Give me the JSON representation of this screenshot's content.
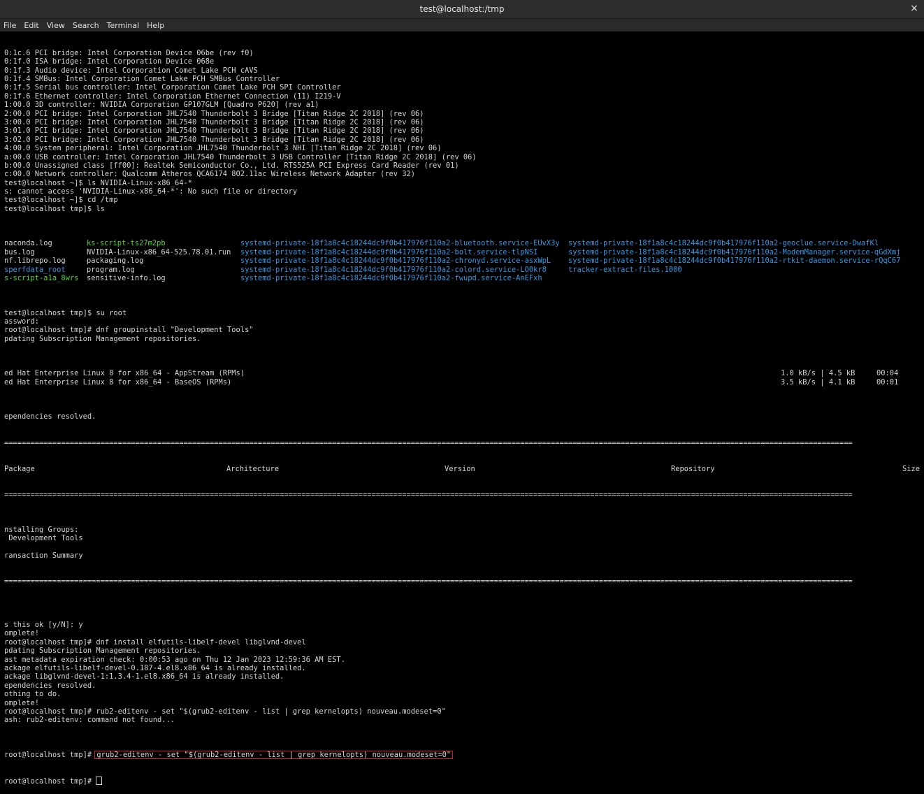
{
  "window": {
    "title": "test@localhost:/tmp",
    "close_glyph": "×"
  },
  "menu": [
    "File",
    "Edit",
    "View",
    "Search",
    "Terminal",
    "Help"
  ],
  "lines_top": [
    "0:1c.6 PCI bridge: Intel Corporation Device 06be (rev f0)",
    "0:1f.0 ISA bridge: Intel Corporation Device 068e",
    "0:1f.3 Audio device: Intel Corporation Comet Lake PCH cAVS",
    "0:1f.4 SMBus: Intel Corporation Comet Lake PCH SMBus Controller",
    "0:1f.5 Serial bus controller: Intel Corporation Comet Lake PCH SPI Controller",
    "0:1f.6 Ethernet controller: Intel Corporation Ethernet Connection (11) I219-V",
    "1:00.0 3D controller: NVIDIA Corporation GP107GLM [Quadro P620] (rev a1)",
    "2:00.0 PCI bridge: Intel Corporation JHL7540 Thunderbolt 3 Bridge [Titan Ridge 2C 2018] (rev 06)",
    "3:00.0 PCI bridge: Intel Corporation JHL7540 Thunderbolt 3 Bridge [Titan Ridge 2C 2018] (rev 06)",
    "3:01.0 PCI bridge: Intel Corporation JHL7540 Thunderbolt 3 Bridge [Titan Ridge 2C 2018] (rev 06)",
    "3:02.0 PCI bridge: Intel Corporation JHL7540 Thunderbolt 3 Bridge [Titan Ridge 2C 2018] (rev 06)",
    "4:00.0 System peripheral: Intel Corporation JHL7540 Thunderbolt 3 NHI [Titan Ridge 2C 2018] (rev 06)",
    "a:00.0 USB controller: Intel Corporation JHL7540 Thunderbolt 3 USB Controller [Titan Ridge 2C 2018] (rev 06)",
    "b:00.0 Unassigned class [ff00]: Realtek Semiconductor Co., Ltd. RTS525A PCI Express Card Reader (rev 01)",
    "c:00.0 Network controller: Qualcomm Atheros QCA6174 802.11ac Wireless Network Adapter (rev 32)",
    "test@localhost ~]$ ls NVIDIA-Linux-x86_64-*",
    "s: cannot access 'NVIDIA-Linux-x86_64-*': No such file or directory",
    "test@localhost ~]$ cd /tmp",
    "test@localhost tmp]$ ls"
  ],
  "ls": {
    "col1": [
      "naconda.log",
      "bus.log",
      "nf.librepo.log",
      "sperfdata_root",
      "s-script-a1a_8wrs"
    ],
    "col2": [
      "ks-script-ts27m2pb",
      "NVIDIA-Linux-x86_64-525.78.01.run",
      "packaging.log",
      "program.log",
      "sensitive-info.log"
    ],
    "col3": [
      "systemd-private-18f1a8c4c18244dc9f0b417976f110a2-bluetooth.service-EUvX3y",
      "systemd-private-18f1a8c4c18244dc9f0b417976f110a2-bolt.service-tlpNSI",
      "systemd-private-18f1a8c4c18244dc9f0b417976f110a2-chronyd.service-asxWpL",
      "systemd-private-18f1a8c4c18244dc9f0b417976f110a2-colord.service-LO0kr8",
      "systemd-private-18f1a8c4c18244dc9f0b417976f110a2-fwupd.service-AnEFxh"
    ],
    "col4": [
      "systemd-private-18f1a8c4c18244dc9f0b417976f110a2-geoclue.service-DwafKl",
      "systemd-private-18f1a8c4c18244dc9f0b417976f110a2-ModemManager.service-qGdXmj",
      "systemd-private-18f1a8c4c18244dc9f0b417976f110a2-rtkit-daemon.service-rQqC67",
      "tracker-extract-files.1000"
    ]
  },
  "lines_mid": [
    "test@localhost tmp]$ su root",
    "assword:",
    "root@localhost tmp]# dnf groupinstall \"Development Tools\"",
    "pdating Subscription Management repositories."
  ],
  "repos": [
    {
      "name": "ed Hat Enterprise Linux 8 for x86_64 - AppStream (RPMs)",
      "rate": "1.0 kB/s | 4.5 kB",
      "time": "00:04"
    },
    {
      "name": "ed Hat Enterprise Linux 8 for x86_64 - BaseOS (RPMs)",
      "rate": "3.5 kB/s | 4.1 kB",
      "time": "00:01"
    }
  ],
  "deps_resolved": "ependencies resolved.",
  "table_header": {
    "package": "Package",
    "arch": "Architecture",
    "version": "Version",
    "repo": "Repository",
    "size": "Size"
  },
  "lines_install": [
    "nstalling Groups:",
    " Development Tools",
    "",
    "ransaction Summary"
  ],
  "lines_bottom": [
    "",
    "s this ok [y/N]: y",
    "omplete!",
    "root@localhost tmp]# dnf install elfutils-libelf-devel libglvnd-devel",
    "pdating Subscription Management repositories.",
    "ast metadata expiration check: 0:00:53 ago on Thu 12 Jan 2023 12:59:36 AM EST.",
    "ackage elfutils-libelf-devel-0.187-4.el8.x86_64 is already installed.",
    "ackage libglvnd-devel-1:1.3.4-1.el8.x86_64 is already installed.",
    "ependencies resolved.",
    "othing to do.",
    "omplete!",
    "root@localhost tmp]# rub2-editenv - set \"$(grub2-editenv - list | grep kernelopts) nouveau.modeset=0\"",
    "ash: rub2-editenv: command not found..."
  ],
  "highlight_line": {
    "prompt": "root@localhost tmp]# ",
    "command": "grub2-editenv - set \"$(grub2-editenv - list | grep kernelopts) nouveau.modeset=0\""
  },
  "final_prompt": "root@localhost tmp]# ",
  "colors": {
    "highlight_border": "#d02020",
    "ls_green": "#55d82b",
    "ls_blue": "#2f9be6"
  }
}
